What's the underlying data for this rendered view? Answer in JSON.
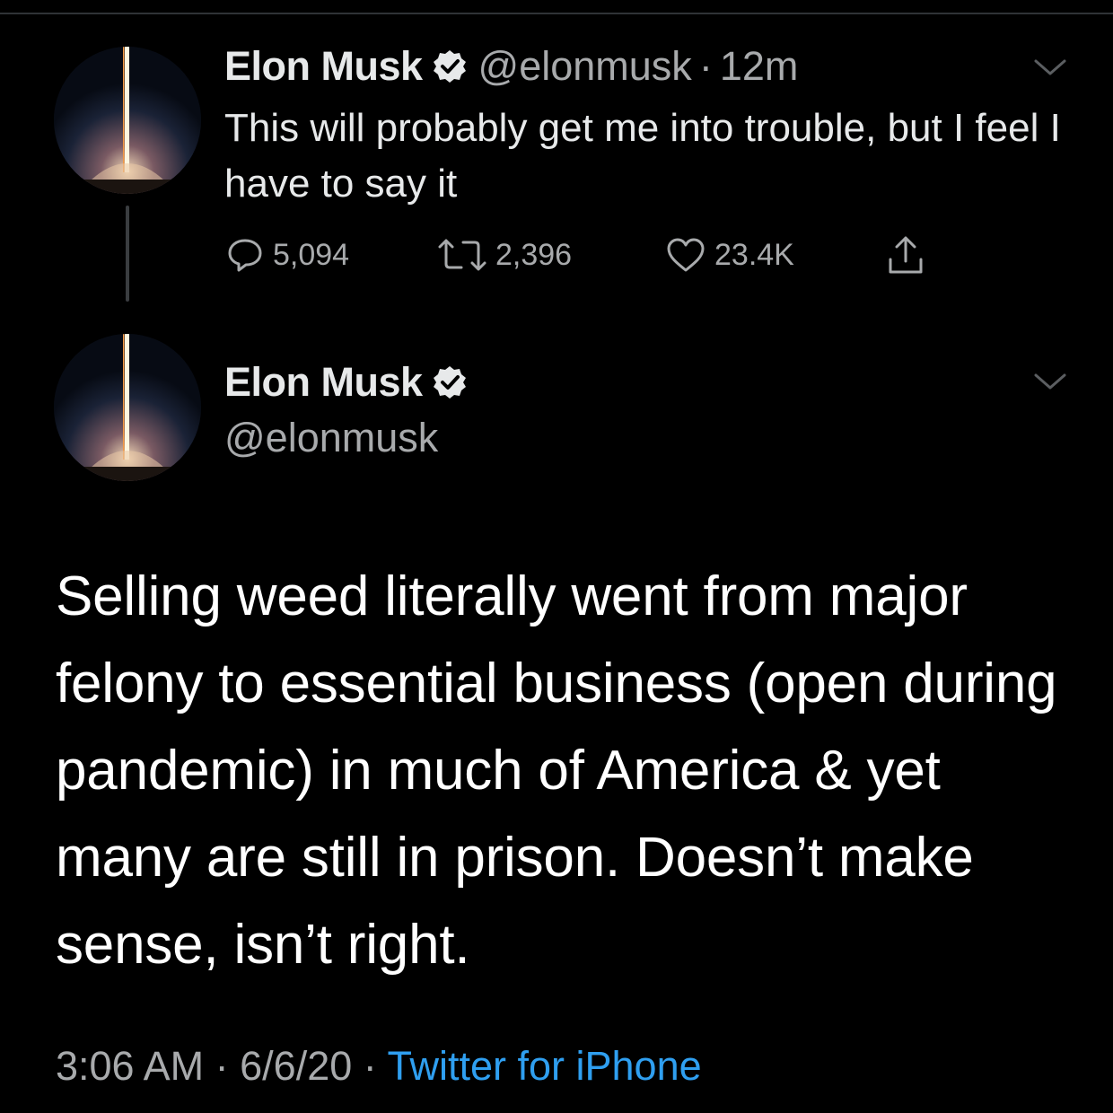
{
  "tweet1": {
    "author_name": "Elon Musk",
    "handle": "@elonmusk",
    "separator": "·",
    "age": "12m",
    "text": "This will probably get me into trouble, but I feel I have to say it",
    "reply_count": "5,094",
    "retweet_count": "2,396",
    "like_count": "23.4K"
  },
  "tweet2": {
    "author_name": "Elon Musk",
    "handle": "@elonmusk",
    "text": "Selling weed literally went from major felony to essential business (open during pandemic) in much of America & yet many are still in prison. Doesn’t make sense, isn’t right.",
    "time": "3:06 AM",
    "separator": "·",
    "date": "6/6/20",
    "source": "Twitter for iPhone"
  },
  "icons": {
    "verified": "verified-badge-icon",
    "reply": "reply-icon",
    "retweet": "retweet-icon",
    "like": "like-icon",
    "share": "share-icon",
    "more": "chevron-down-icon"
  },
  "colors": {
    "background": "#000000",
    "text": "#e7e9ea",
    "muted": "#a8aaac",
    "link": "#2f9ff0"
  }
}
